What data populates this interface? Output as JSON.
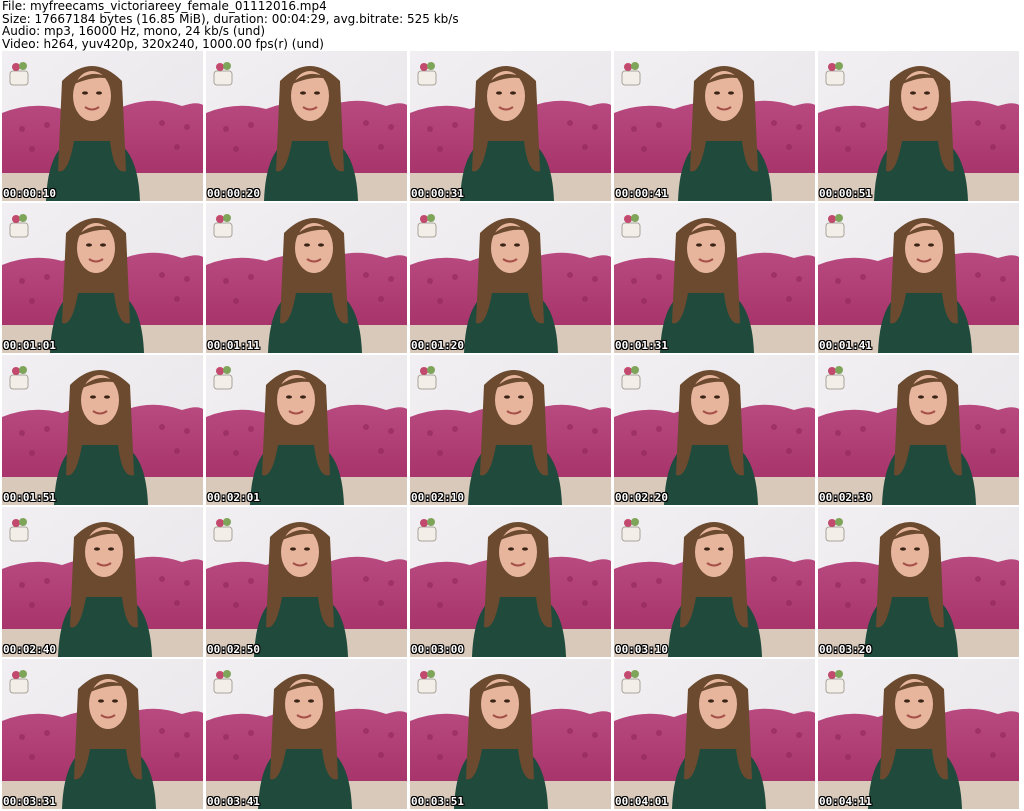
{
  "header": {
    "file_line": "File: myfreecams_victoriareey_female_01112016.mp4",
    "size_line": "Size: 17667184 bytes (16.85 MiB), duration: 00:04:29, avg.bitrate: 525 kb/s",
    "audio_line": "Audio: mp3, 16000 Hz, mono, 24 kb/s (und)",
    "video_line": "Video: h264, yuv420p, 320x240, 1000.00 fps(r) (und)"
  },
  "grid": {
    "columns": 5,
    "rows": 5,
    "thumbnails": [
      {
        "timestamp": "00:00:10"
      },
      {
        "timestamp": "00:00:20"
      },
      {
        "timestamp": "00:00:31"
      },
      {
        "timestamp": "00:00:41"
      },
      {
        "timestamp": "00:00:51"
      },
      {
        "timestamp": "00:01:01"
      },
      {
        "timestamp": "00:01:11"
      },
      {
        "timestamp": "00:01:20"
      },
      {
        "timestamp": "00:01:31"
      },
      {
        "timestamp": "00:01:41"
      },
      {
        "timestamp": "00:01:51"
      },
      {
        "timestamp": "00:02:01"
      },
      {
        "timestamp": "00:02:10"
      },
      {
        "timestamp": "00:02:20"
      },
      {
        "timestamp": "00:02:30"
      },
      {
        "timestamp": "00:02:40"
      },
      {
        "timestamp": "00:02:50"
      },
      {
        "timestamp": "00:03:00"
      },
      {
        "timestamp": "00:03:10"
      },
      {
        "timestamp": "00:03:20"
      },
      {
        "timestamp": "00:03:31"
      },
      {
        "timestamp": "00:03:41"
      },
      {
        "timestamp": "00:03:51"
      },
      {
        "timestamp": "00:04:01"
      },
      {
        "timestamp": "00:04:11"
      }
    ]
  },
  "colors": {
    "wall": "#e9e6ea",
    "sofa": "#a6336a",
    "sweater": "#1f4a3c",
    "hair": "#6b4a2f",
    "skin": "#e7b59c",
    "timestamp_text": "#ffffff"
  }
}
